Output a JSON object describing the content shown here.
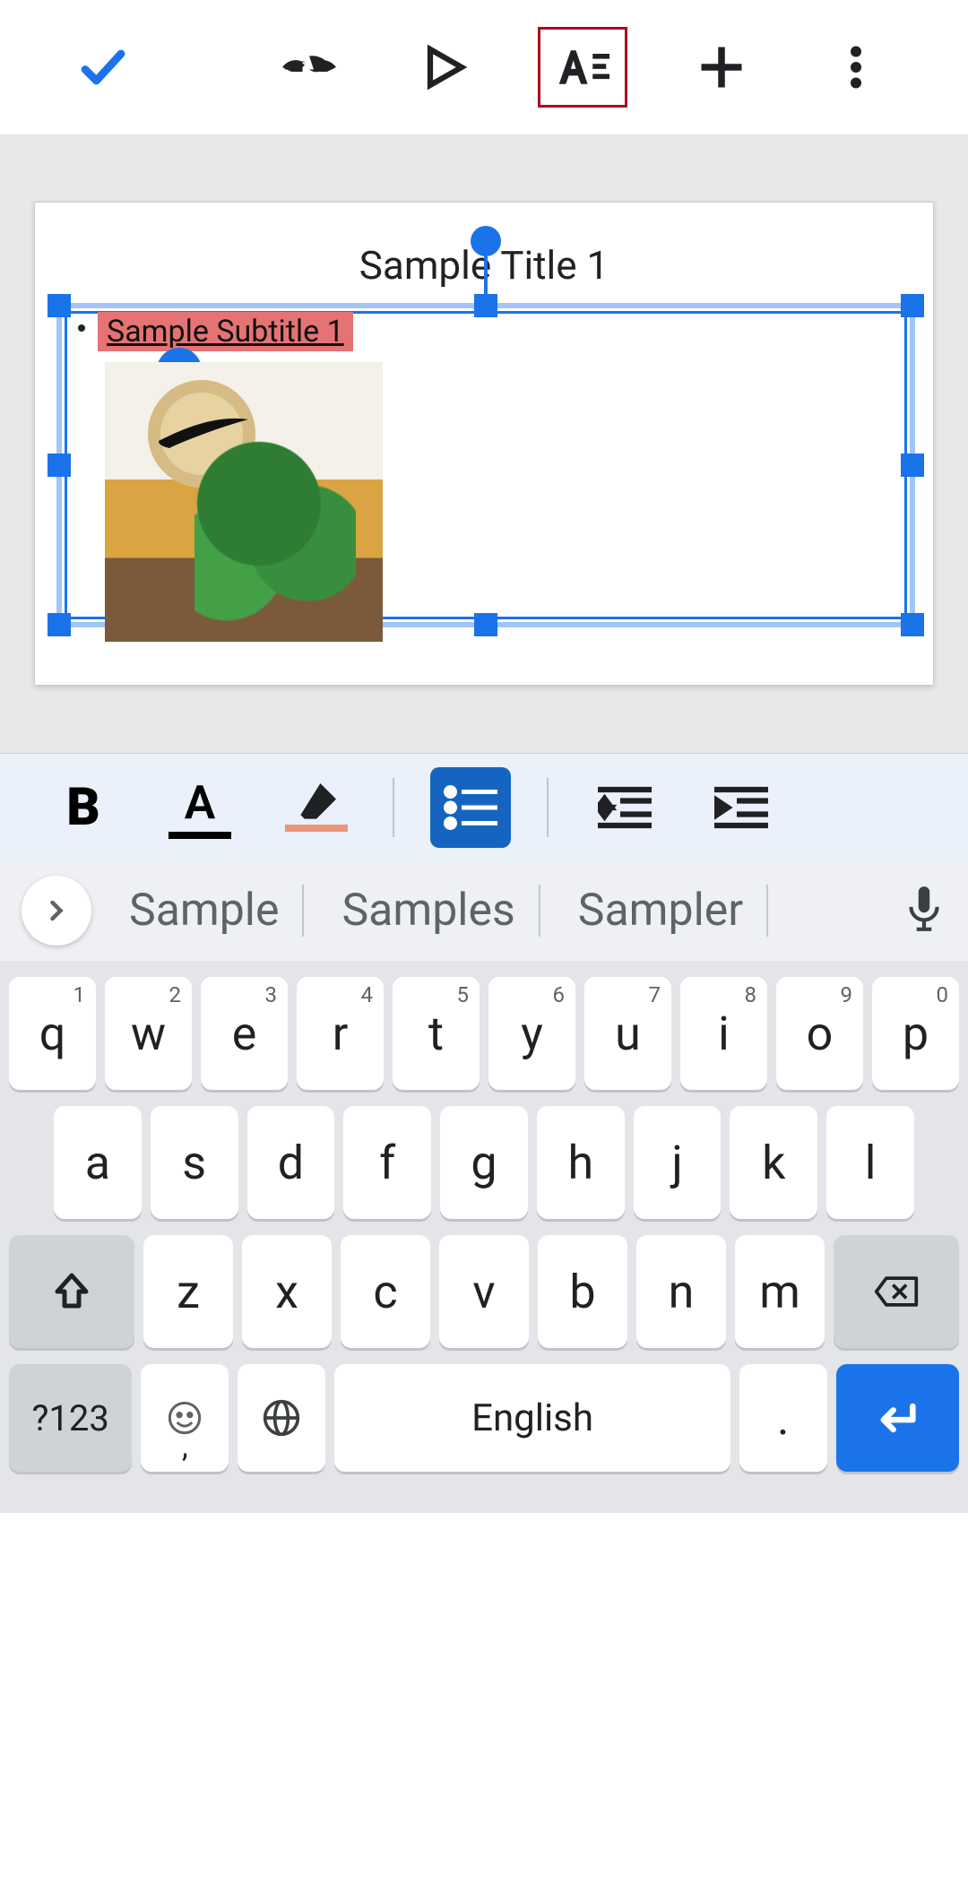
{
  "toolbar": {
    "confirm": "✓",
    "undo": "undo",
    "redo_combo": "undo-redo",
    "play": "play",
    "format": "A≡",
    "add": "+",
    "more": "⋮"
  },
  "slide": {
    "title": "Sample Title 1",
    "subtitle": "Sample Subtitle 1"
  },
  "format_strip": {
    "bold": "B",
    "text_color": "A",
    "highlight": "✎",
    "bullets": "≣",
    "outdent": "⇤",
    "indent": "⇥"
  },
  "suggestions": {
    "items": [
      "Sample",
      "Samples",
      "Sampler"
    ]
  },
  "keyboard": {
    "row1": [
      {
        "k": "q",
        "n": "1"
      },
      {
        "k": "w",
        "n": "2"
      },
      {
        "k": "e",
        "n": "3"
      },
      {
        "k": "r",
        "n": "4"
      },
      {
        "k": "t",
        "n": "5"
      },
      {
        "k": "y",
        "n": "6"
      },
      {
        "k": "u",
        "n": "7"
      },
      {
        "k": "i",
        "n": "8"
      },
      {
        "k": "o",
        "n": "9"
      },
      {
        "k": "p",
        "n": "0"
      }
    ],
    "row2": [
      "a",
      "s",
      "d",
      "f",
      "g",
      "h",
      "j",
      "k",
      "l"
    ],
    "row3": [
      "z",
      "x",
      "c",
      "v",
      "b",
      "n",
      "m"
    ],
    "sym": "?123",
    "emoji_sub": ",",
    "space": "English",
    "period": "."
  }
}
